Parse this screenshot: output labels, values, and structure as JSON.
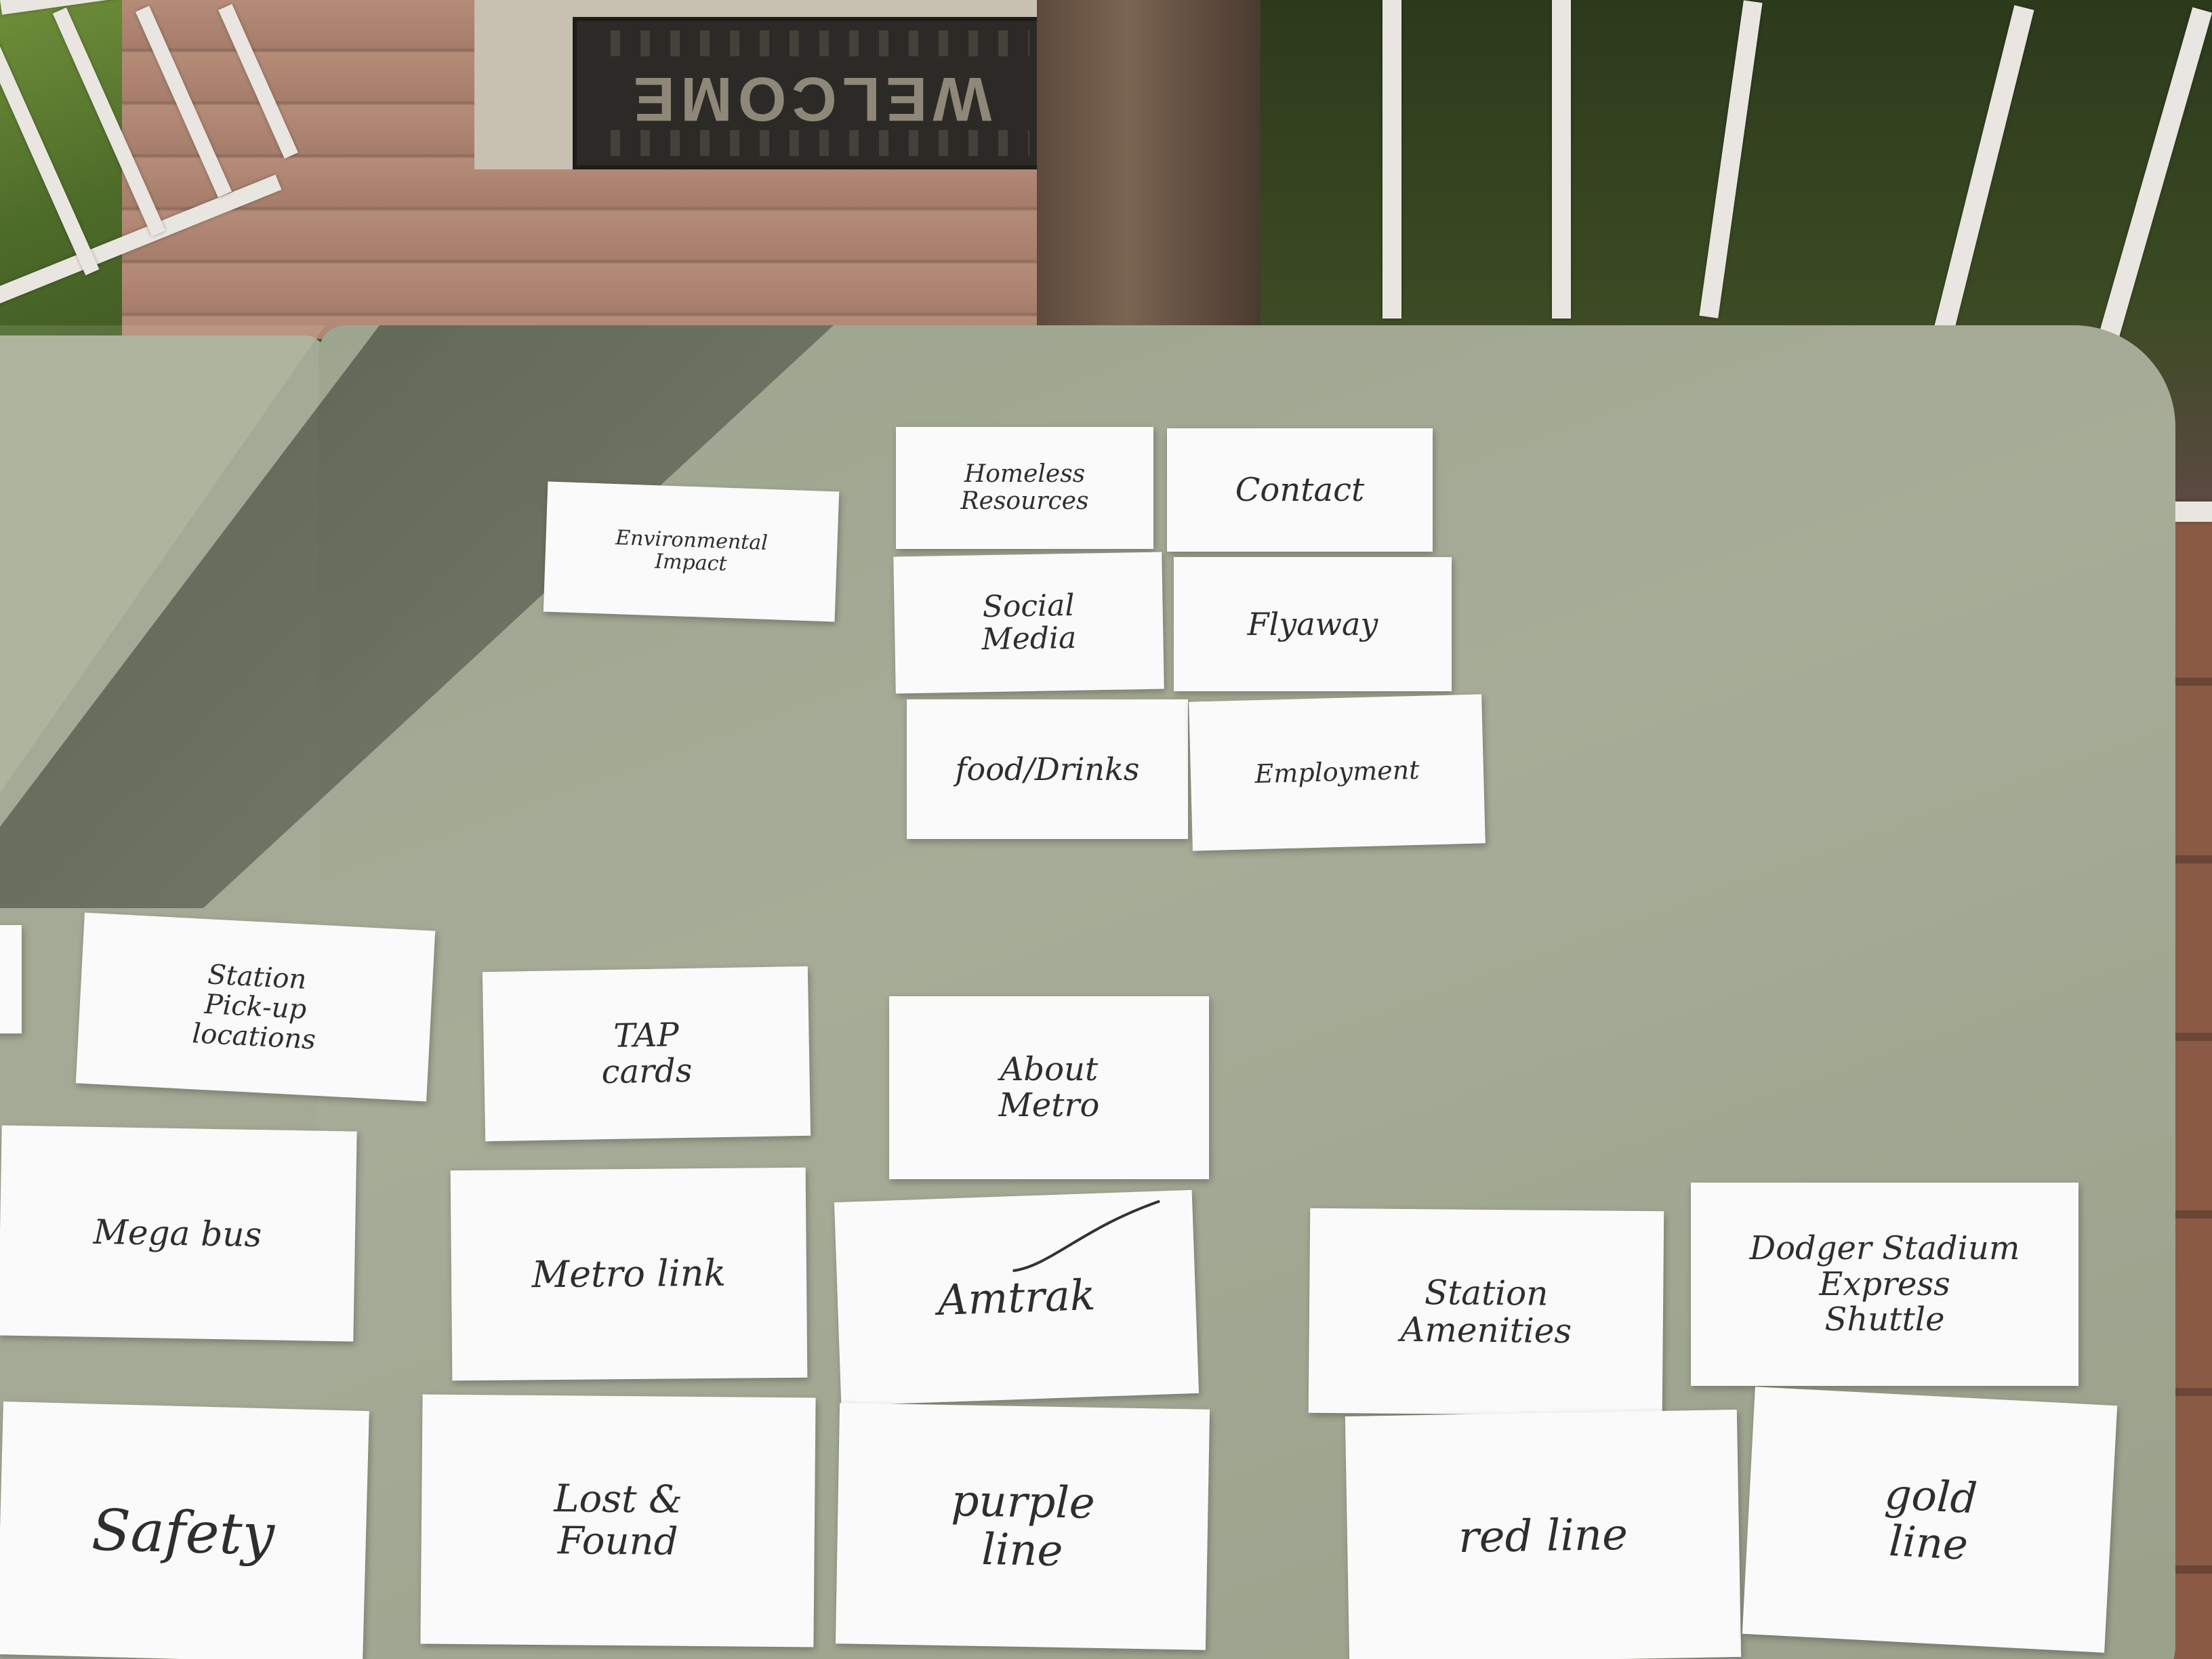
{
  "doormat": {
    "text": "WELCOME"
  },
  "cards": {
    "environmental_impact": "Environmental\nImpact",
    "homeless_resources": "Homeless\nResources",
    "contact": "Contact",
    "social_media": "Social\nMedia",
    "flyaway": "Flyaway",
    "food_drinks": "food/Drinks",
    "employment": "Employment",
    "station_pickup": "Station\nPick-up\nlocations",
    "tap_cards": "TAP\ncards",
    "about_metro": "About\nMetro",
    "mega_bus": "Mega bus",
    "metro_link": "Metro link",
    "amtrak": "Amtrak",
    "station_amenities": "Station\nAmenities",
    "dodger_stadium": "Dodger Stadium\nExpress\nShuttle",
    "safety": "Safety",
    "lost_found": "Lost &\nFound",
    "purple_line": "purple\nline",
    "red_line": "red line",
    "gold_line": "gold\nline"
  },
  "colors": {
    "table": "#a4aa95",
    "card": "#fafafa",
    "ink": "#2e2e2e"
  }
}
